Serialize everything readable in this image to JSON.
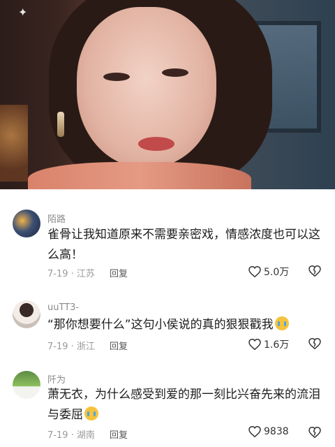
{
  "comments": [
    {
      "username": "陌路",
      "text": "雀骨让我知道原来不需要亲密戏，情感浓度也可以这么高！",
      "date": "7-19",
      "location": "江苏",
      "reply_label": "回复",
      "likes": "5.0万",
      "avatar_icon": "avatar-night-scene"
    },
    {
      "username": "uuTT3-",
      "text": "“那你想要什么”这句小侯说的真的狠狠戳我",
      "emoji": "crying-face",
      "date": "7-19",
      "location": "浙江",
      "reply_label": "回复",
      "likes": "1.6万",
      "avatar_icon": "avatar-portrait"
    },
    {
      "username": "阡为",
      "text": "萧无衣，为什么感受到爱的那一刻比兴奋先来的流泪与委屈",
      "emoji": "crying-face",
      "date": "7-19",
      "location": "湖南",
      "reply_label": "回复",
      "likes": "9838",
      "avatar_icon": "avatar-green-field"
    }
  ],
  "colors": {
    "username": "#8b8b8b",
    "text": "#1c1c1c",
    "meta": "#999999"
  }
}
